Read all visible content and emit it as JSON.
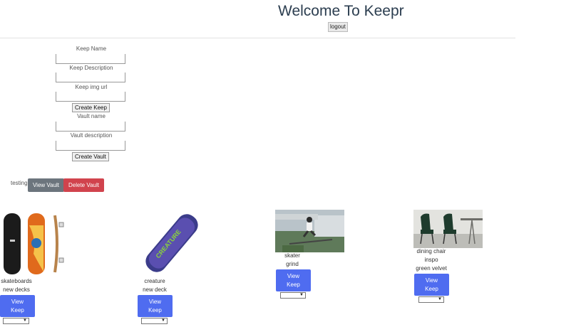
{
  "header": {
    "title": "Welcome To Keepr",
    "logout_label": "logout"
  },
  "keep_form": {
    "name_label": "Keep Name",
    "description_label": "Keep Description",
    "img_label": "Keep img url",
    "create_label": "Create Keep"
  },
  "vault_form": {
    "name_label": "Vault name",
    "description_label": "Vault description",
    "create_label": "Create Vault"
  },
  "vault": {
    "name": "testing",
    "view_label": "View Vault",
    "delete_label": "Delete Vault"
  },
  "keeps": [
    {
      "name": "skateboards",
      "description": "new decks",
      "image": "skateboard-decks-image",
      "button": "View Keep"
    },
    {
      "name": "creature",
      "description": "new deck",
      "image": "creature-skateboard-image",
      "button": "View Keep"
    },
    {
      "name": "skater",
      "description": "grind",
      "image": "skater-grind-photo",
      "button": "View Keep"
    },
    {
      "name": "dining chair",
      "description": "inspo",
      "extra": "green velvet",
      "image": "green-velvet-chairs-photo",
      "button": "View Keep"
    }
  ],
  "colors": {
    "primary": "#4f6cf0",
    "secondary": "#6c757d",
    "danger": "#d1434d"
  }
}
